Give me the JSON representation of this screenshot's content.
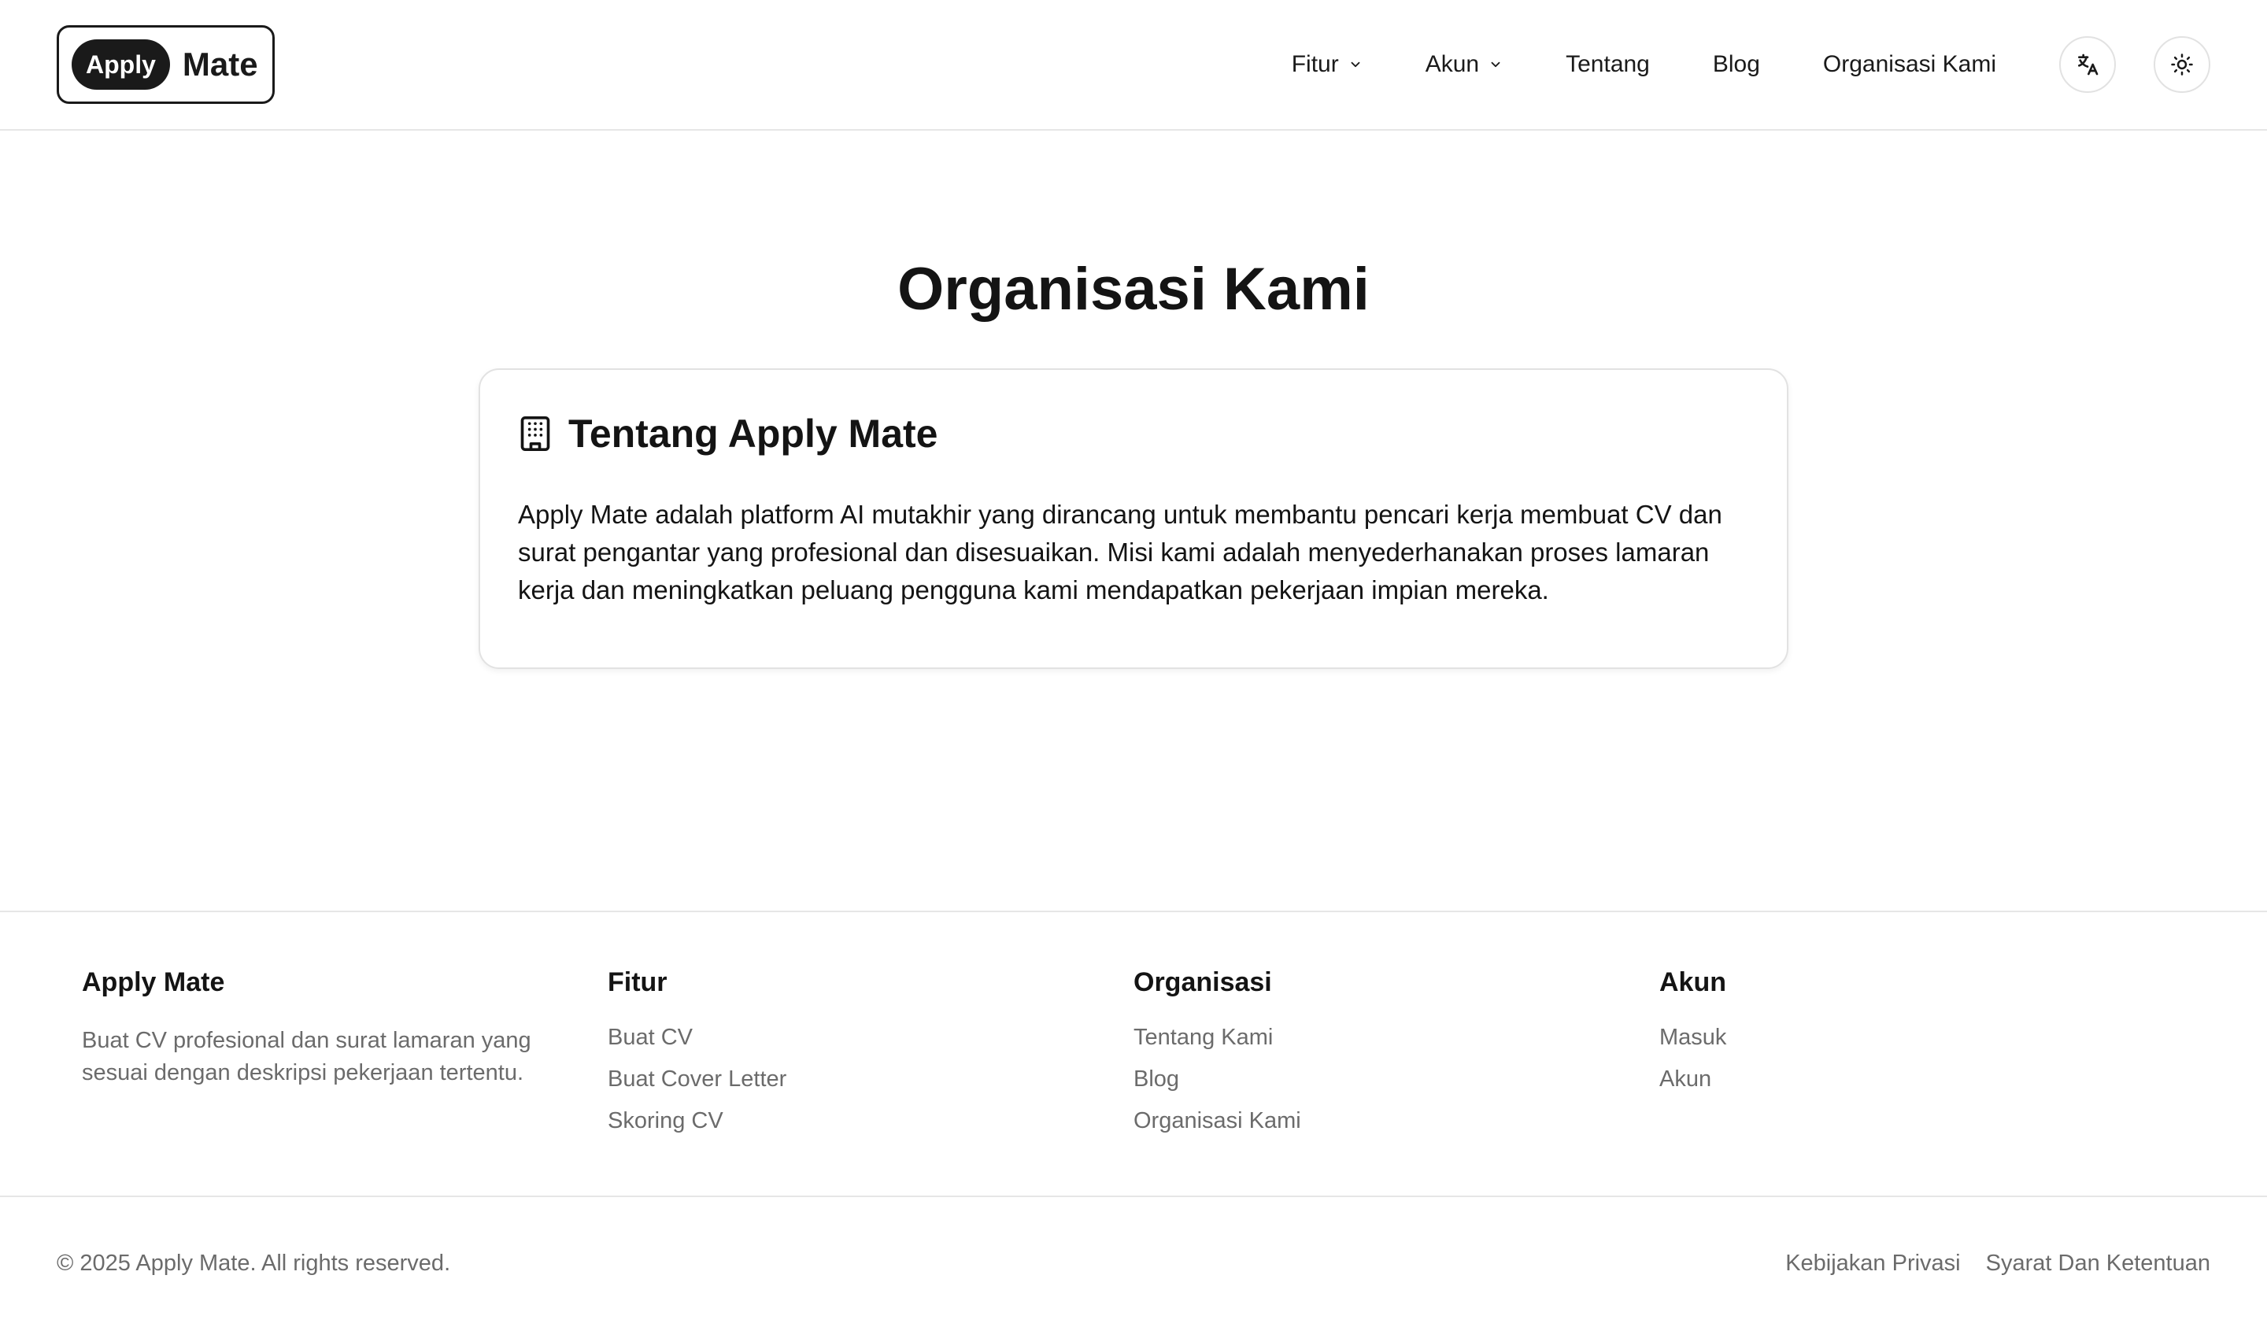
{
  "header": {
    "logo_pill": "Apply",
    "logo_word": "Mate",
    "nav": [
      {
        "label": "Fitur"
      },
      {
        "label": "Akun"
      },
      {
        "label": "Tentang"
      },
      {
        "label": "Blog"
      },
      {
        "label": "Organisasi Kami"
      }
    ],
    "icons": {
      "language": "translate-icon",
      "theme": "sun-icon",
      "dropdown": "chevron-down-icon"
    }
  },
  "main": {
    "title": "Organisasi Kami",
    "card": {
      "icon": "building-icon",
      "title": "Tentang Apply Mate",
      "body": "Apply Mate adalah platform AI mutakhir yang dirancang untuk membantu pencari kerja membuat CV dan surat pengantar yang profesional dan disesuaikan. Misi kami adalah menyederhanakan proses lamaran kerja dan meningkatkan peluang pengguna kami mendapatkan pekerjaan impian mereka."
    }
  },
  "footer": {
    "brand": {
      "title": "Apply Mate",
      "description": "Buat CV profesional dan surat lamaran yang sesuai dengan deskripsi pekerjaan tertentu."
    },
    "columns": [
      {
        "title": "Fitur",
        "links": [
          "Buat CV",
          "Buat Cover Letter",
          "Skoring CV"
        ]
      },
      {
        "title": "Organisasi",
        "links": [
          "Tentang Kami",
          "Blog",
          "Organisasi Kami"
        ]
      },
      {
        "title": "Akun",
        "links": [
          "Masuk",
          "Akun"
        ]
      }
    ],
    "copyright": "© 2025 Apply Mate. All rights reserved.",
    "legal": [
      "Kebijakan Privasi",
      "Syarat Dan Ketentuan"
    ]
  },
  "colors": {
    "text": "#141414",
    "muted": "#6b6b6b",
    "border": "#e2e2e2",
    "brand": "#1a1a1a"
  }
}
